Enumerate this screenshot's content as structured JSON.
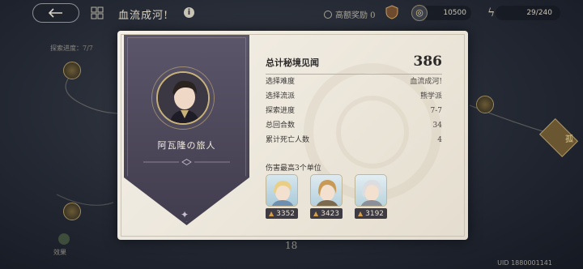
{
  "header": {
    "title": "血流成河!",
    "reward_text": "高额奖励 0",
    "currency_value": "10500",
    "stamina_value": "29/240"
  },
  "background": {
    "explore_progress": "探索进度：7/7",
    "bottom_count": "18",
    "bottom_label": "效果",
    "right_tag": "孤"
  },
  "card": {
    "player_name": "阿瓦隆の旅人",
    "total_label": "总计秘境见闻",
    "total_value": "386",
    "rows": [
      {
        "label": "选择难度",
        "value": "血流成河!"
      },
      {
        "label": "选择流派",
        "value": "熊学派"
      },
      {
        "label": "探索进度",
        "value": "7-7"
      },
      {
        "label": "总回合数",
        "value": "34"
      },
      {
        "label": "累计死亡人数",
        "value": "4"
      }
    ],
    "damage_title": "伤害最高3个单位",
    "units": [
      {
        "damage": "3352"
      },
      {
        "damage": "3423"
      },
      {
        "damage": "3192"
      }
    ]
  },
  "footer": {
    "uid": "UID 1880001141"
  },
  "colors": {
    "card_bg": "#f0ebe1",
    "banner": "#4f4a5d",
    "gold": "#c9b27a"
  }
}
